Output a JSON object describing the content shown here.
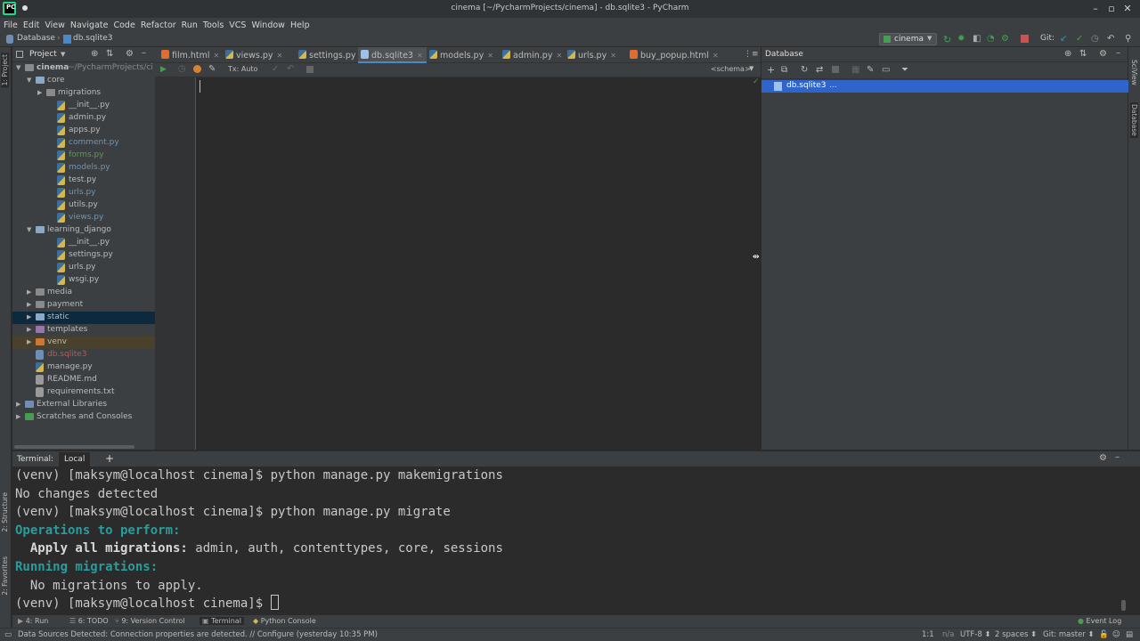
{
  "window": {
    "title": "cinema [~/PycharmProjects/cinema] - db.sqlite3 - PyCharm"
  },
  "menu": [
    "File",
    "Edit",
    "View",
    "Navigate",
    "Code",
    "Refactor",
    "Run",
    "Tools",
    "VCS",
    "Window",
    "Help"
  ],
  "breadcrumb": {
    "root": "Database",
    "file": "db.sqlite3"
  },
  "run_config": "cinema",
  "git_label": "Git:",
  "left_stripe": {
    "project": "1: Project",
    "structure": "2: Structure",
    "favorites": "2: Favorites"
  },
  "right_stripe": {
    "sciview": "SciView",
    "database": "Database"
  },
  "project_panel": {
    "title": "Project",
    "tree": [
      {
        "label": "cinema",
        "suffix": " ~/PycharmProjects/ci",
        "kind": "folder",
        "depth": 0,
        "arrow": "▼",
        "bold": true
      },
      {
        "label": "core",
        "kind": "folder",
        "depth": 1,
        "arrow": "▼"
      },
      {
        "label": "migrations",
        "kind": "folder",
        "depth": 2,
        "arrow": "▶"
      },
      {
        "label": "__init__.py",
        "kind": "py",
        "depth": 3
      },
      {
        "label": "admin.py",
        "kind": "py",
        "depth": 3
      },
      {
        "label": "apps.py",
        "kind": "py",
        "depth": 3
      },
      {
        "label": "comment.py",
        "kind": "py",
        "depth": 3,
        "color": "#6897bb"
      },
      {
        "label": "forms.py",
        "kind": "py",
        "depth": 3,
        "color": "#629755"
      },
      {
        "label": "models.py",
        "kind": "py",
        "depth": 3,
        "color": "#6897bb"
      },
      {
        "label": "test.py",
        "kind": "py",
        "depth": 3
      },
      {
        "label": "urls.py",
        "kind": "py",
        "depth": 3,
        "color": "#6897bb"
      },
      {
        "label": "utils.py",
        "kind": "py",
        "depth": 3
      },
      {
        "label": "views.py",
        "kind": "py",
        "depth": 3,
        "color": "#6897bb"
      },
      {
        "label": "learning_django",
        "kind": "folder",
        "depth": 1,
        "arrow": "▼"
      },
      {
        "label": "__init__.py",
        "kind": "py",
        "depth": 3
      },
      {
        "label": "settings.py",
        "kind": "py",
        "depth": 3
      },
      {
        "label": "urls.py",
        "kind": "py",
        "depth": 3
      },
      {
        "label": "wsgi.py",
        "kind": "py",
        "depth": 3
      },
      {
        "label": "media",
        "kind": "folder",
        "depth": 1,
        "arrow": "▶"
      },
      {
        "label": "payment",
        "kind": "folder",
        "depth": 1,
        "arrow": "▶"
      },
      {
        "label": "static",
        "kind": "folder",
        "depth": 1,
        "arrow": "▶",
        "highlight": "#0d293e"
      },
      {
        "label": "templates",
        "kind": "folder-purple",
        "depth": 1,
        "arrow": "▶"
      },
      {
        "label": "venv",
        "kind": "folder-orange",
        "depth": 1,
        "arrow": "▶",
        "highlight": "#49412c"
      },
      {
        "label": "db.sqlite3",
        "kind": "db",
        "depth": 1,
        "color": "#c75450"
      },
      {
        "label": "manage.py",
        "kind": "py",
        "depth": 1
      },
      {
        "label": "README.md",
        "kind": "md",
        "depth": 1
      },
      {
        "label": "requirements.txt",
        "kind": "txt",
        "depth": 1
      },
      {
        "label": "External Libraries",
        "kind": "lib",
        "depth": 0,
        "arrow": "▶"
      },
      {
        "label": "Scratches and Consoles",
        "kind": "scratch",
        "depth": 0,
        "arrow": "▶"
      }
    ]
  },
  "editor_tabs": [
    {
      "label": "film.html",
      "kind": "html"
    },
    {
      "label": "views.py",
      "kind": "py"
    },
    {
      "label": "settings.py",
      "kind": "py"
    },
    {
      "label": "db.sqlite3",
      "kind": "db",
      "active": true
    },
    {
      "label": "models.py",
      "kind": "py"
    },
    {
      "label": "admin.py",
      "kind": "py"
    },
    {
      "label": "urls.py",
      "kind": "py"
    },
    {
      "label": "buy_popup.html",
      "kind": "html"
    }
  ],
  "editor_toolbar": {
    "tx": "Tx: Auto",
    "schema": "<schema>"
  },
  "database_panel": {
    "title": "Database",
    "selected_item": "db.sqlite3",
    "selected_suffix": "..."
  },
  "terminal": {
    "label": "Terminal:",
    "tab": "Local",
    "add": "+",
    "lines": [
      {
        "segments": [
          {
            "text": "(venv) [maksym@localhost cinema]$ python manage.py makemigrations",
            "style": ""
          }
        ]
      },
      {
        "segments": [
          {
            "text": "No changes detected",
            "style": ""
          }
        ]
      },
      {
        "segments": [
          {
            "text": "(venv) [maksym@localhost cinema]$ python manage.py migrate",
            "style": ""
          }
        ]
      },
      {
        "segments": [
          {
            "text": "Operations to perform:",
            "style": "cyan"
          }
        ]
      },
      {
        "segments": [
          {
            "text": "  Apply all migrations:",
            "style": "bold"
          },
          {
            "text": " admin, auth, contenttypes, core, sessions",
            "style": ""
          }
        ]
      },
      {
        "segments": [
          {
            "text": "Running migrations:",
            "style": "cyan"
          }
        ]
      },
      {
        "segments": [
          {
            "text": "  No migrations to apply.",
            "style": ""
          }
        ]
      },
      {
        "segments": [
          {
            "text": "(venv) [maksym@localhost cinema]$ ",
            "style": ""
          }
        ],
        "cursor": true
      }
    ]
  },
  "bottom_tools": [
    {
      "label": "4: Run",
      "icon": "run-icon"
    },
    {
      "label": "6: TODO",
      "icon": "todo-icon"
    },
    {
      "label": "9: Version Control",
      "icon": "vcs-icon"
    },
    {
      "label": "Terminal",
      "icon": "terminal-icon",
      "active": true
    },
    {
      "label": "Python Console",
      "icon": "python-console-icon"
    }
  ],
  "event_log": "Event Log",
  "status": {
    "message": "Data Sources Detected: Connection properties are detected. // Configure (yesterday 10:35 PM)",
    "position": "1:1",
    "na": "n/a",
    "encoding": "UTF-8",
    "indent": "2 spaces",
    "git": "Git: master"
  },
  "colors": {
    "accent": "#4a88c7",
    "selection": "#2f65ca",
    "terminal_cyan": "#2a9c9c"
  }
}
